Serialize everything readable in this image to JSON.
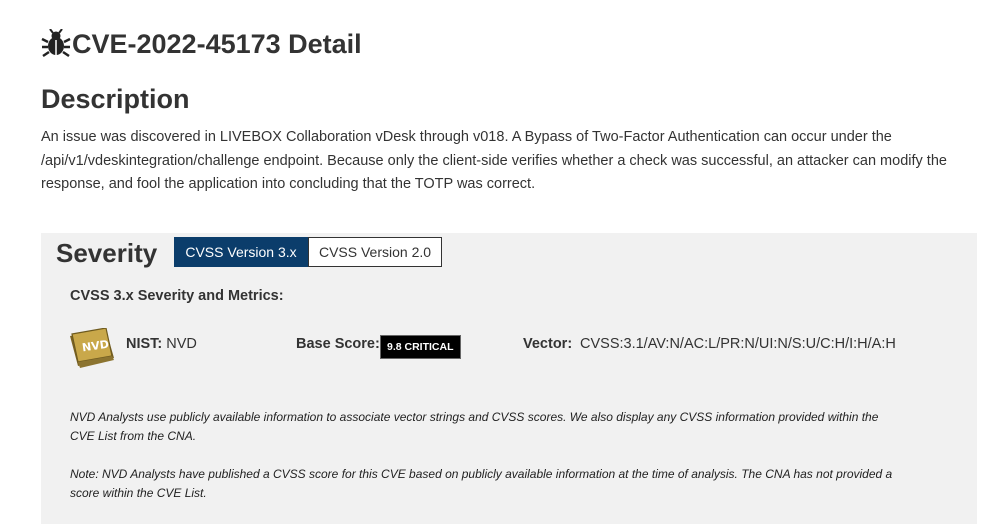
{
  "header": {
    "title": "CVE-2022-45173 Detail",
    "icon": "bug-icon"
  },
  "description": {
    "heading": "Description",
    "text": "An issue was discovered in LIVEBOX Collaboration vDesk through v018. A Bypass of Two-Factor Authentication can occur under the /api/v1/vdeskintegration/challenge endpoint. Because only the client-side verifies whether a check was successful, an attacker can modify the response, and fool the application into concluding that the TOTP was correct."
  },
  "severity": {
    "heading": "Severity",
    "tabs": [
      {
        "label": "CVSS Version 3.x",
        "active": true
      },
      {
        "label": "CVSS Version 2.0",
        "active": false
      }
    ],
    "metrics_heading": "CVSS 3.x Severity and Metrics:",
    "logo_text": "NVD",
    "nist_label": "NIST:",
    "nist_value": "NVD",
    "base_score_label": "Base Score:",
    "base_score_badge": "9.8 CRITICAL",
    "vector_label": "Vector:",
    "vector_value": "CVSS:3.1/AV:N/AC:L/PR:N/UI:N/S:U/C:H/I:H/A:H",
    "note1": "NVD Analysts use publicly available information to associate vector strings and CVSS scores. We also display any CVSS information provided within the CVE List from the CNA.",
    "note2": "Note: NVD Analysts have published a CVSS score for this CVE based on publicly available information at the time of analysis. The CNA has not provided a score within the CVE List."
  },
  "colors": {
    "active_tab": "#0b3d6b",
    "panel_bg": "#f1f1f1",
    "badge_bg": "#000000",
    "logo_gold": "#b8973a"
  }
}
